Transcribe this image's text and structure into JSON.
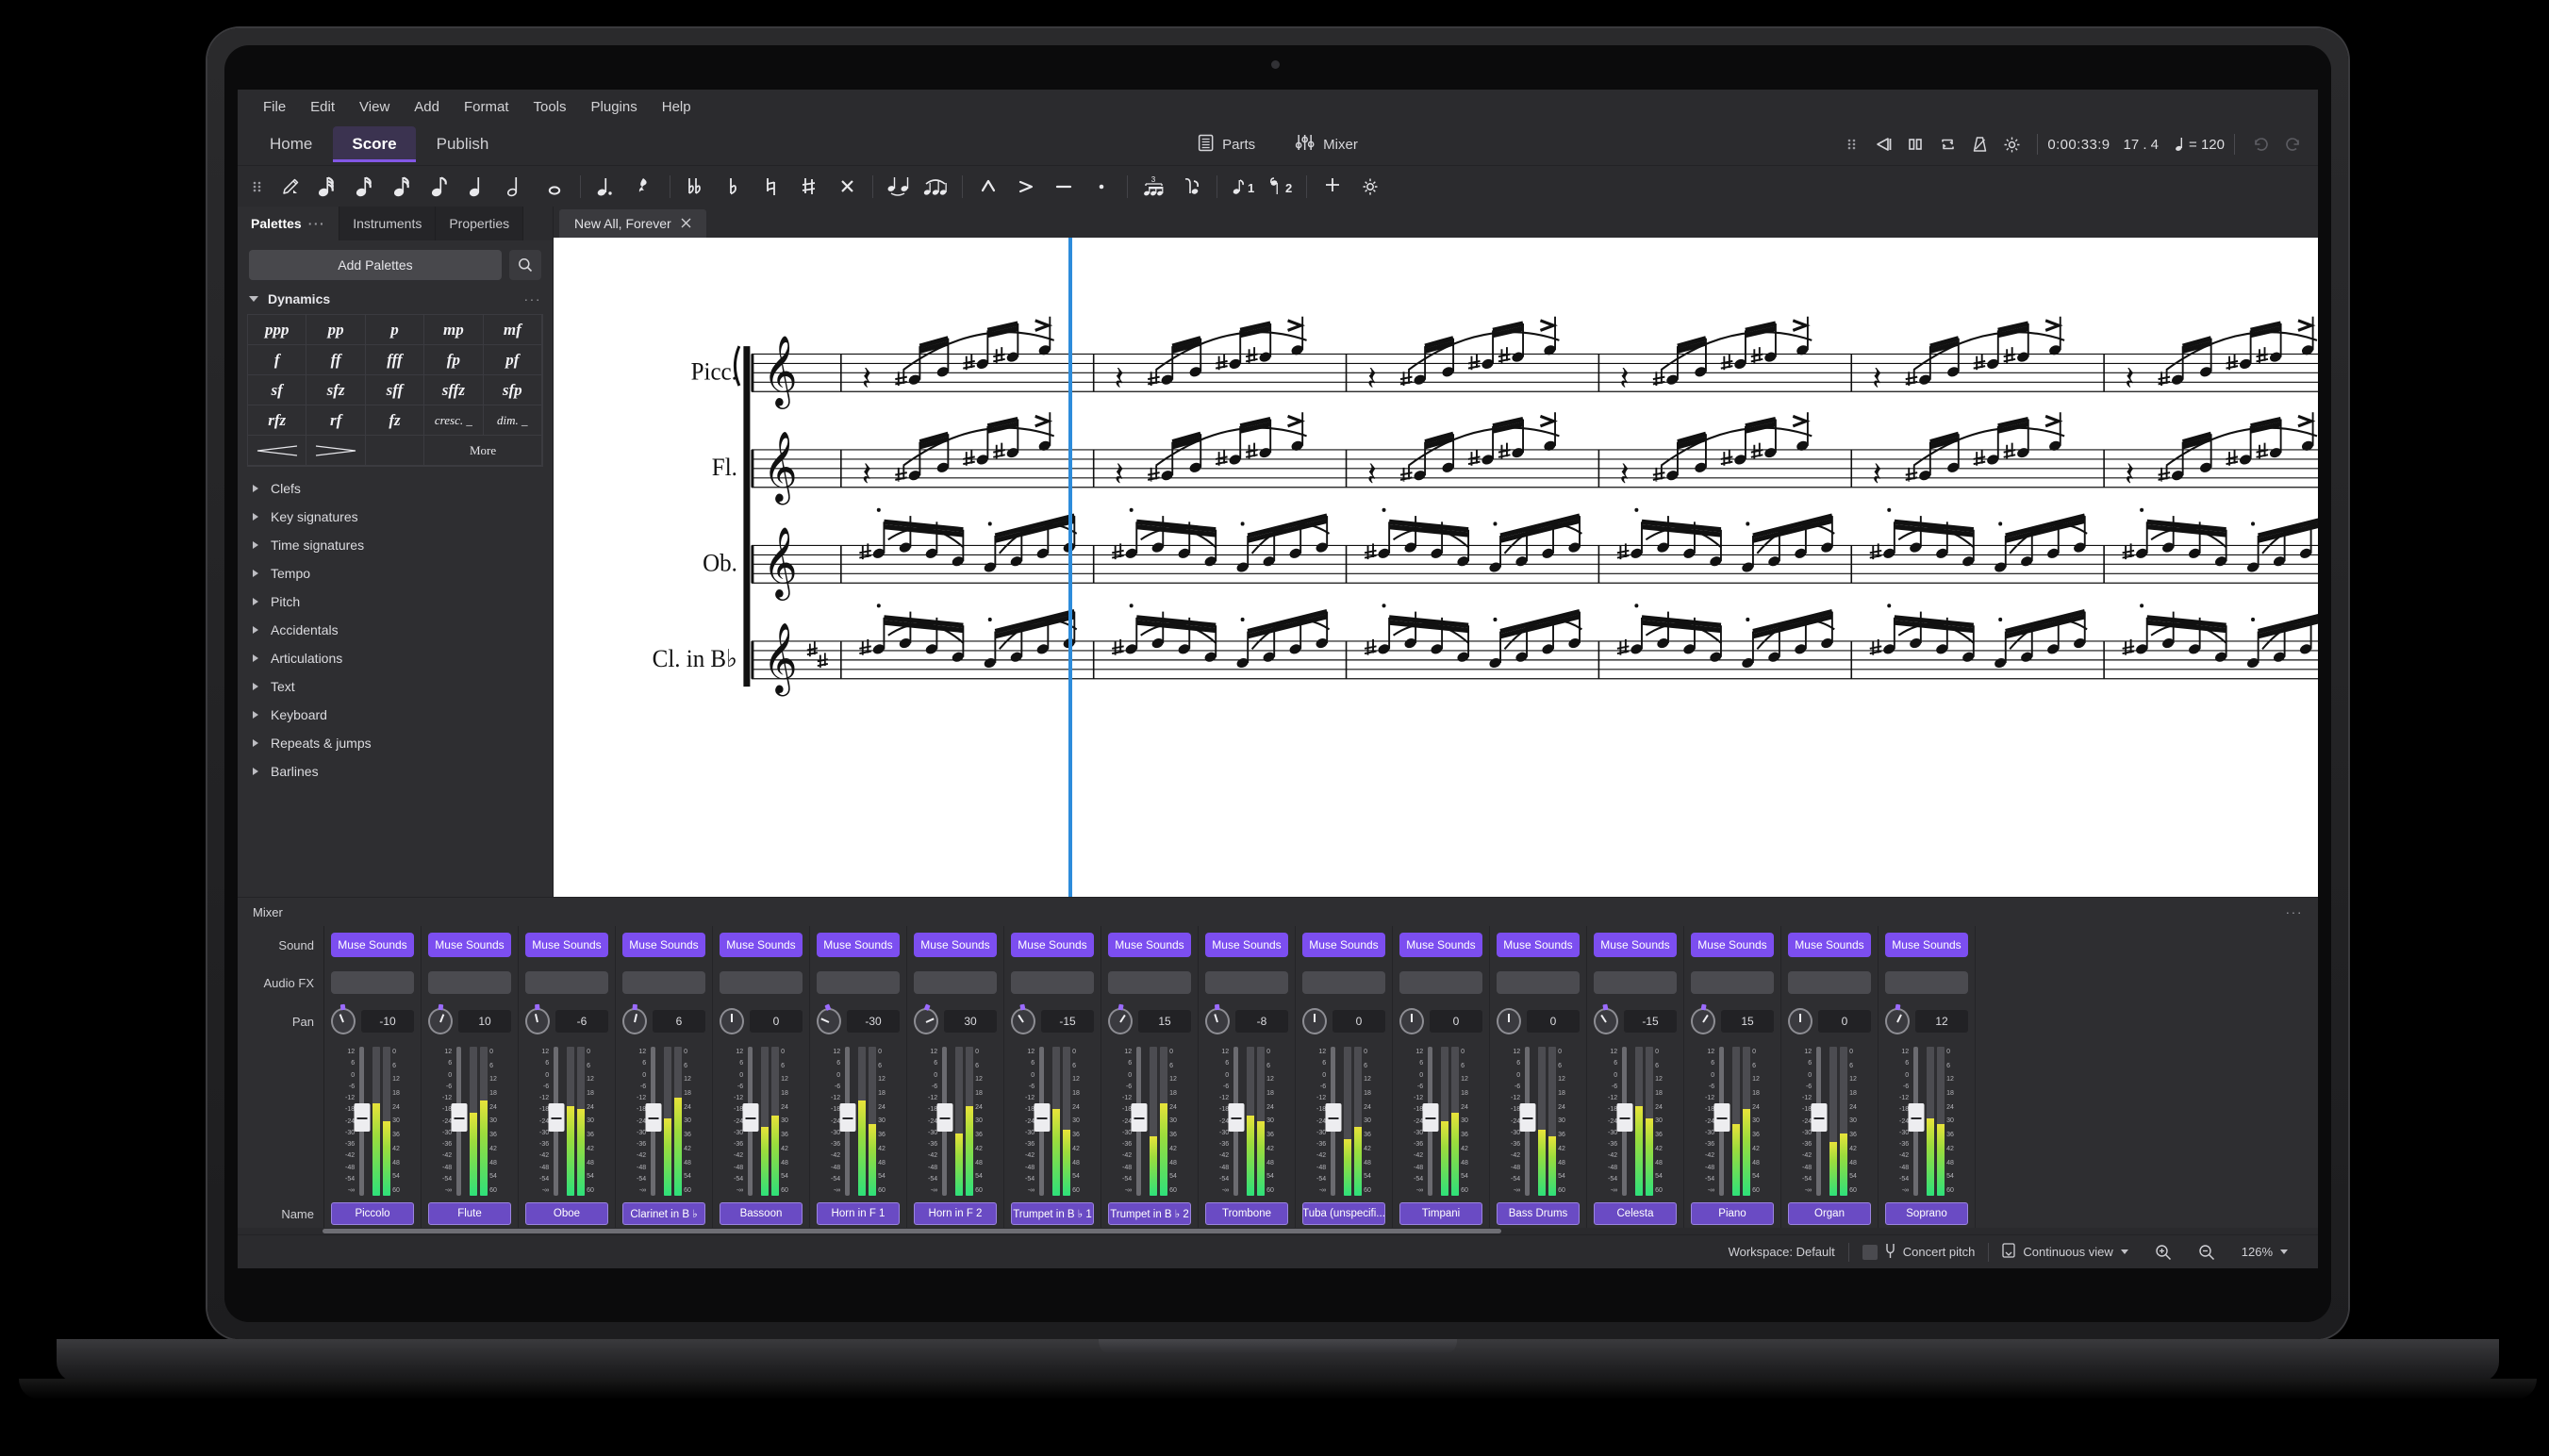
{
  "app": {
    "menu": [
      "File",
      "Edit",
      "View",
      "Add",
      "Format",
      "Tools",
      "Plugins",
      "Help"
    ],
    "tabs": [
      {
        "label": "Home",
        "active": false
      },
      {
        "label": "Score",
        "active": true
      },
      {
        "label": "Publish",
        "active": false
      }
    ],
    "parts_label": "Parts",
    "mixer_label": "Mixer",
    "timecode": "0:00:33:9",
    "measure": "17 . 4",
    "tempo": "= 120",
    "accent_color": "#7c4ef0",
    "playhead_color": "#2d8cdb"
  },
  "document": {
    "tab_title": "New All, Forever"
  },
  "notebar": {
    "durations": [
      "pencil-note-input",
      "64th-note",
      "32nd-note",
      "16th-note",
      "eighth-note",
      "quarter-note",
      "half-note",
      "whole-note"
    ],
    "dot_rest": [
      "dotted-note",
      "rest"
    ],
    "accidentals": [
      "double-flat",
      "flat",
      "natural",
      "sharp",
      "double-sharp"
    ],
    "ties": [
      "tie",
      "slur"
    ],
    "articulations": [
      "marcato",
      "accent",
      "tenuto",
      "staccato"
    ],
    "tuplets": [
      "triplet",
      "flip-stem"
    ],
    "voices": [
      "voice-1",
      "voice-2"
    ],
    "extra": [
      "add",
      "settings"
    ]
  },
  "palettes": {
    "tabs": [
      {
        "label": "Palettes",
        "active": true
      },
      {
        "label": "Instruments",
        "active": false
      },
      {
        "label": "Properties",
        "active": false
      }
    ],
    "add_button": "Add Palettes",
    "search_icon": "search-icon",
    "dynamics": {
      "title": "Dynamics",
      "cells": [
        "ppp",
        "pp",
        "p",
        "mp",
        "mf",
        "f",
        "ff",
        "fff",
        "fp",
        "pf",
        "sf",
        "sfz",
        "sff",
        "sffz",
        "sfp",
        "rfz",
        "rf",
        "fz",
        "cresc. _",
        "dim. _"
      ],
      "hairpins": [
        "crescendo-hairpin",
        "diminuendo-hairpin"
      ],
      "more_label": "More"
    },
    "sections": [
      "Clefs",
      "Key signatures",
      "Time signatures",
      "Tempo",
      "Pitch",
      "Accidentals",
      "Articulations",
      "Text",
      "Keyboard",
      "Repeats & jumps",
      "Barlines"
    ]
  },
  "score": {
    "staves": [
      "Picc.",
      "Fl.",
      "Ob.",
      "Cl. in B♭"
    ]
  },
  "mixer": {
    "title": "Mixer",
    "row_labels": {
      "sound": "Sound",
      "audio_fx": "Audio FX",
      "pan": "Pan",
      "name": "Name"
    },
    "fader_scale_left": [
      "12",
      "6",
      "0",
      "-6",
      "-12",
      "-18",
      "-24",
      "-30",
      "-36",
      "-42",
      "-48",
      "-54",
      "-∞"
    ],
    "meter_scale_right": [
      "0",
      "6",
      "12",
      "18",
      "24",
      "30",
      "36",
      "42",
      "48",
      "54",
      "60"
    ],
    "sound_label": "Muse Sounds",
    "channels": [
      {
        "name": "Piccolo",
        "pan": "-10",
        "meterL": 62,
        "meterR": 50
      },
      {
        "name": "Flute",
        "pan": "10",
        "meterL": 56,
        "meterR": 64
      },
      {
        "name": "Oboe",
        "pan": "-6",
        "meterL": 60,
        "meterR": 58
      },
      {
        "name": "Clarinet in B ♭",
        "pan": "6",
        "meterL": 52,
        "meterR": 66
      },
      {
        "name": "Bassoon",
        "pan": "0",
        "meterL": 46,
        "meterR": 54
      },
      {
        "name": "Horn in F 1",
        "pan": "-30",
        "meterL": 64,
        "meterR": 48
      },
      {
        "name": "Horn in F 2",
        "pan": "30",
        "meterL": 42,
        "meterR": 60
      },
      {
        "name": "Trumpet in B ♭ 1",
        "pan": "-15",
        "meterL": 58,
        "meterR": 44
      },
      {
        "name": "Trumpet in B ♭ 2",
        "pan": "15",
        "meterL": 40,
        "meterR": 62
      },
      {
        "name": "Trombone",
        "pan": "-8",
        "meterL": 54,
        "meterR": 50
      },
      {
        "name": "Tuba (unspecifi...",
        "pan": "0",
        "meterL": 38,
        "meterR": 46
      },
      {
        "name": "Timpani",
        "pan": "0",
        "meterL": 50,
        "meterR": 56
      },
      {
        "name": "Bass Drums",
        "pan": "0",
        "meterL": 44,
        "meterR": 40
      },
      {
        "name": "Celesta",
        "pan": "-15",
        "meterL": 60,
        "meterR": 52
      },
      {
        "name": "Piano",
        "pan": "15",
        "meterL": 48,
        "meterR": 58
      },
      {
        "name": "Organ",
        "pan": "0",
        "meterL": 36,
        "meterR": 42
      },
      {
        "name": "Soprano",
        "pan": "12",
        "meterL": 52,
        "meterR": 48
      }
    ]
  },
  "statusbar": {
    "workspace": "Workspace: Default",
    "concert_pitch": "Concert pitch",
    "view_mode": "Continuous view",
    "zoom": "126%",
    "zoom_in_icon": "zoom-in-icon",
    "zoom_out_icon": "zoom-out-icon"
  }
}
